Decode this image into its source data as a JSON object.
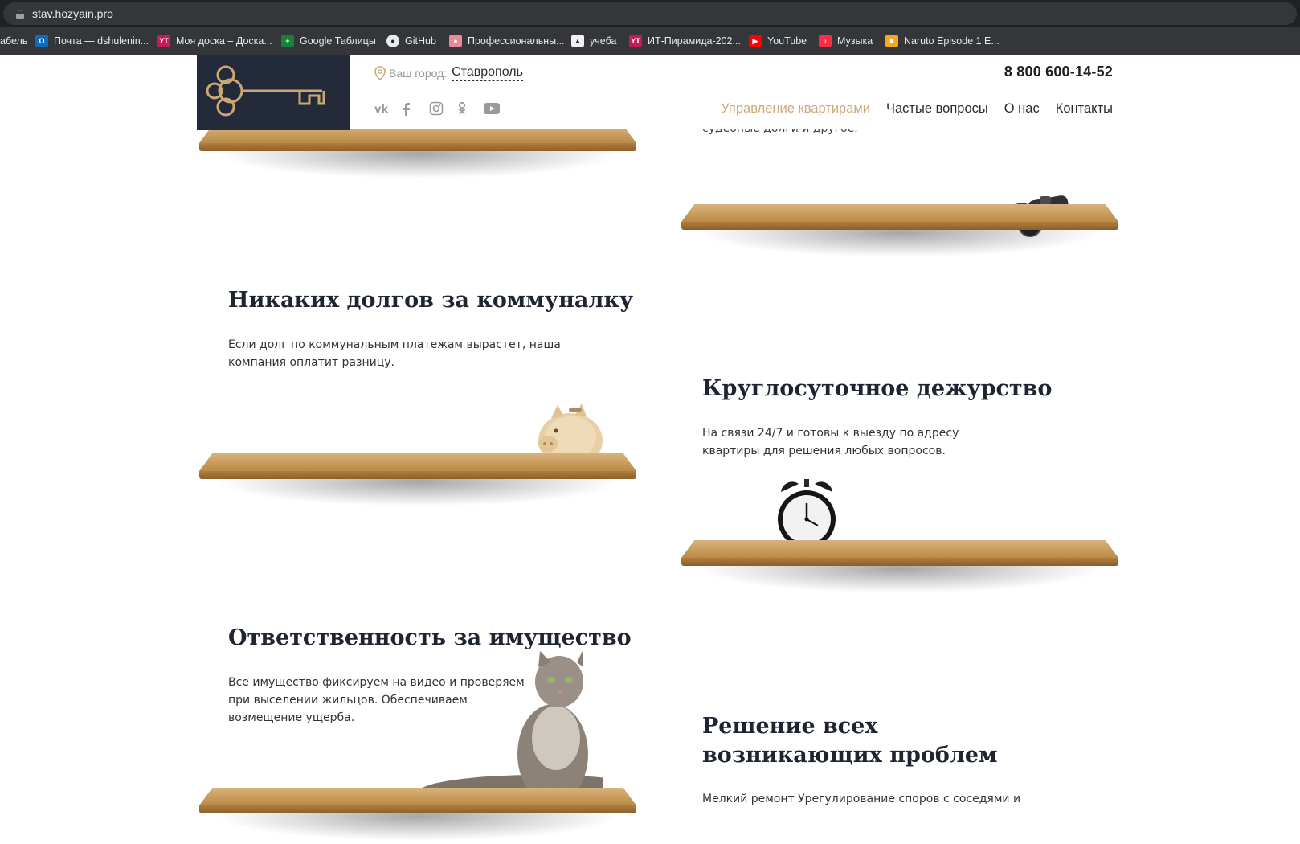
{
  "browser": {
    "url": "stav.hozyain.pro",
    "bookmarks": [
      {
        "label": "абель",
        "icon": "bookmark-icon",
        "color": "#35363a"
      },
      {
        "label": "Почта — dshulenin...",
        "icon": "outlook-icon",
        "color": "#0f6cbd"
      },
      {
        "label": "Моя доска – Доска...",
        "icon": "youtrack-icon",
        "color": "#c21e56"
      },
      {
        "label": "Google Таблицы",
        "icon": "sheets-icon",
        "color": "#188038"
      },
      {
        "label": "GitHub",
        "icon": "github-icon",
        "color": "#e8eaed"
      },
      {
        "label": "Профессиональны...",
        "icon": "brain-icon",
        "color": "#e88a9a"
      },
      {
        "label": "учеба",
        "icon": "penguin-icon",
        "color": "#f2f2f2"
      },
      {
        "label": "ИТ-Пирамида-202...",
        "icon": "youtrack-icon",
        "color": "#c21e56"
      },
      {
        "label": "YouTube",
        "icon": "youtube-icon",
        "color": "#ff0000"
      },
      {
        "label": "Музыка",
        "icon": "music-icon",
        "color": "#fa2d48"
      },
      {
        "label": "Naruto Episode 1 E...",
        "icon": "video-site-icon",
        "color": "#f5a623"
      }
    ]
  },
  "header": {
    "city_label": "Ваш город:",
    "city_value": "Ставрополь",
    "phone": "8 800 600-14-52",
    "nav": [
      "Управление квартирами",
      "Частые вопросы",
      "О нас",
      "Контакты"
    ],
    "socials": [
      "vk-icon",
      "facebook-icon",
      "instagram-icon",
      "odnoklassniki-icon",
      "youtube-icon"
    ],
    "accent_color": "#cfa97a",
    "logo_bg": "#232b3b"
  },
  "content": {
    "partial_top": "судебные долги и другое.",
    "features": [
      {
        "title": "Никаких долгов за коммуналку",
        "text": "Если долг по коммунальным платежам вырастет, наша компания оплатит разницу.",
        "image": "piggy-bank"
      },
      {
        "title": "Круглосуточное дежурство",
        "text": "На связи 24/7 и готовы к выезду по адресу квартиры для решения любых вопросов.",
        "image": "alarm-clock"
      },
      {
        "title": "Ответственность за имущество",
        "text": "Все имущество фиксируем на видео и проверяем при выселении жильцов. Обеспечиваем возмещение ущерба.",
        "image": "cat"
      },
      {
        "title": "Решение всех возникающих проблем",
        "text": "Мелкий ремонт Урегулирование споров с соседями и",
        "image": "none"
      }
    ]
  }
}
